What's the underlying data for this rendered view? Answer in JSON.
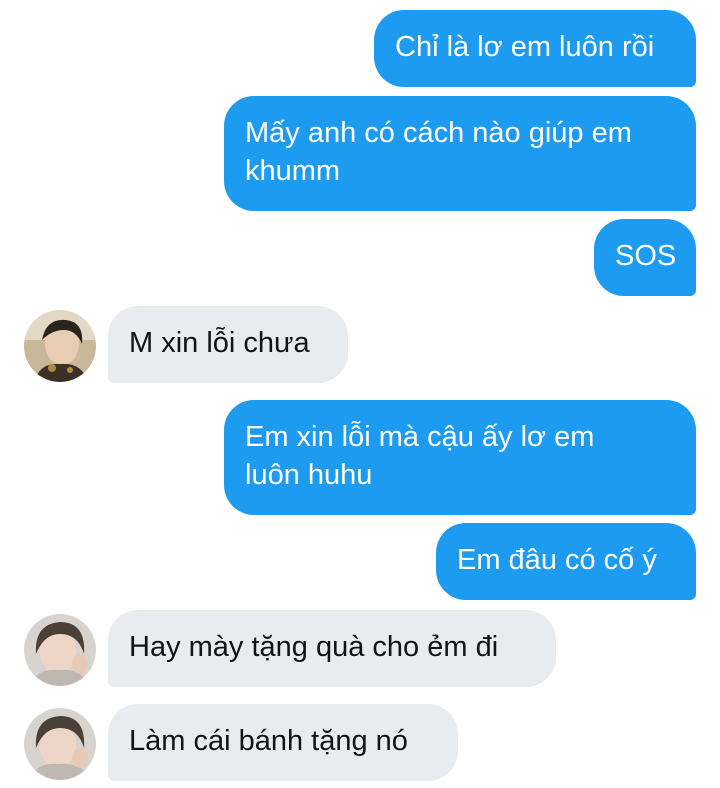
{
  "messages": [
    {
      "direction": "outgoing",
      "text": "Chỉ là lơ em luôn rồi"
    },
    {
      "direction": "outgoing",
      "text": "Mấy anh có cách nào giúp em\nkhumm"
    },
    {
      "direction": "outgoing",
      "text": "SOS"
    },
    {
      "direction": "incoming",
      "text": "M xin lỗi chưa"
    },
    {
      "direction": "outgoing",
      "text": "Em xin lỗi mà cậu ấy lơ em\nluôn huhu"
    },
    {
      "direction": "outgoing",
      "text": "Em đâu có cố ý"
    },
    {
      "direction": "incoming",
      "text": "Hay mày tặng quà cho ẻm đi"
    },
    {
      "direction": "incoming",
      "text": "Làm cái bánh tặng nó"
    }
  ],
  "colors": {
    "outgoing_bubble": "#1d9bf0",
    "incoming_bubble": "#e8ecf0",
    "outgoing_text": "#ffffff",
    "incoming_text": "#0f1419"
  }
}
